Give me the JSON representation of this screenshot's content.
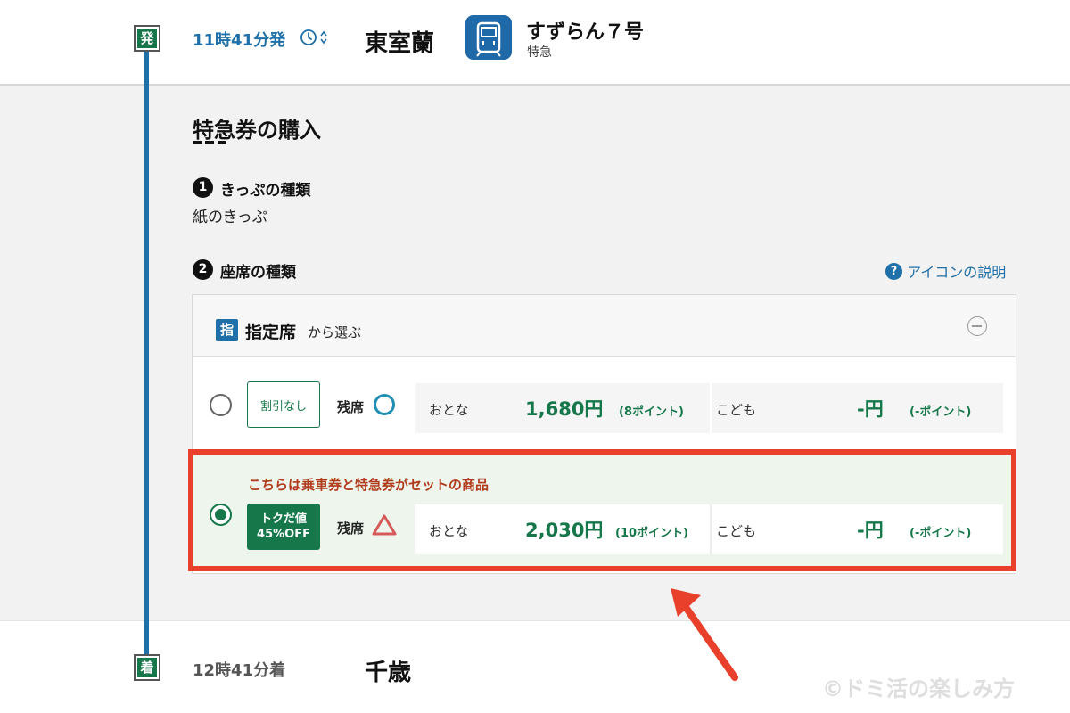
{
  "departure": {
    "badge": "発",
    "time": "11時41分発",
    "station": "東室蘭",
    "clock_icon": "clock-icon",
    "sort_icon": "updown-caret-icon"
  },
  "train": {
    "icon": "train-icon",
    "name": "すずらん７号",
    "type": "特急"
  },
  "section": {
    "title": "特急券の購入"
  },
  "step1": {
    "number": "1",
    "label": "きっぷの種類",
    "value": "紙のきっぷ"
  },
  "step2": {
    "number": "2",
    "label": "座席の種類",
    "help_link": "アイコンの説明",
    "help_icon": "question-circle-icon"
  },
  "seat_group": {
    "badge": "指",
    "title": "指定席",
    "suffix": "から選ぶ",
    "collapse_icon": "minus-circle-icon"
  },
  "options": [
    {
      "selected": false,
      "discount_label": "割引なし",
      "vacancy_label": "残席",
      "vacancy_icon": "circle-available-icon",
      "adult_label": "おとな",
      "adult_price": "1,680円",
      "adult_points": "(8ポイント)",
      "child_label": "こども",
      "child_price": "-円",
      "child_points": "(-ポイント)"
    },
    {
      "selected": true,
      "promo": "こちらは乗車券と特急券がセットの商品",
      "discount_line1": "トクだ値",
      "discount_line2": "45%OFF",
      "vacancy_label": "残席",
      "vacancy_icon": "triangle-few-left-icon",
      "adult_label": "おとな",
      "adult_price": "2,030円",
      "adult_points": "(10ポイント)",
      "child_label": "こども",
      "child_price": "-円",
      "child_points": "(-ポイント)"
    }
  ],
  "arrival": {
    "badge": "着",
    "time": "12時41分着",
    "station": "千歳"
  },
  "watermark": "©ドミ活の楽しみ方",
  "colors": {
    "accent_blue": "#1f6fa8",
    "price_green": "#16784a",
    "highlight_red": "#e8402a",
    "promo_text": "#b03a1a"
  }
}
